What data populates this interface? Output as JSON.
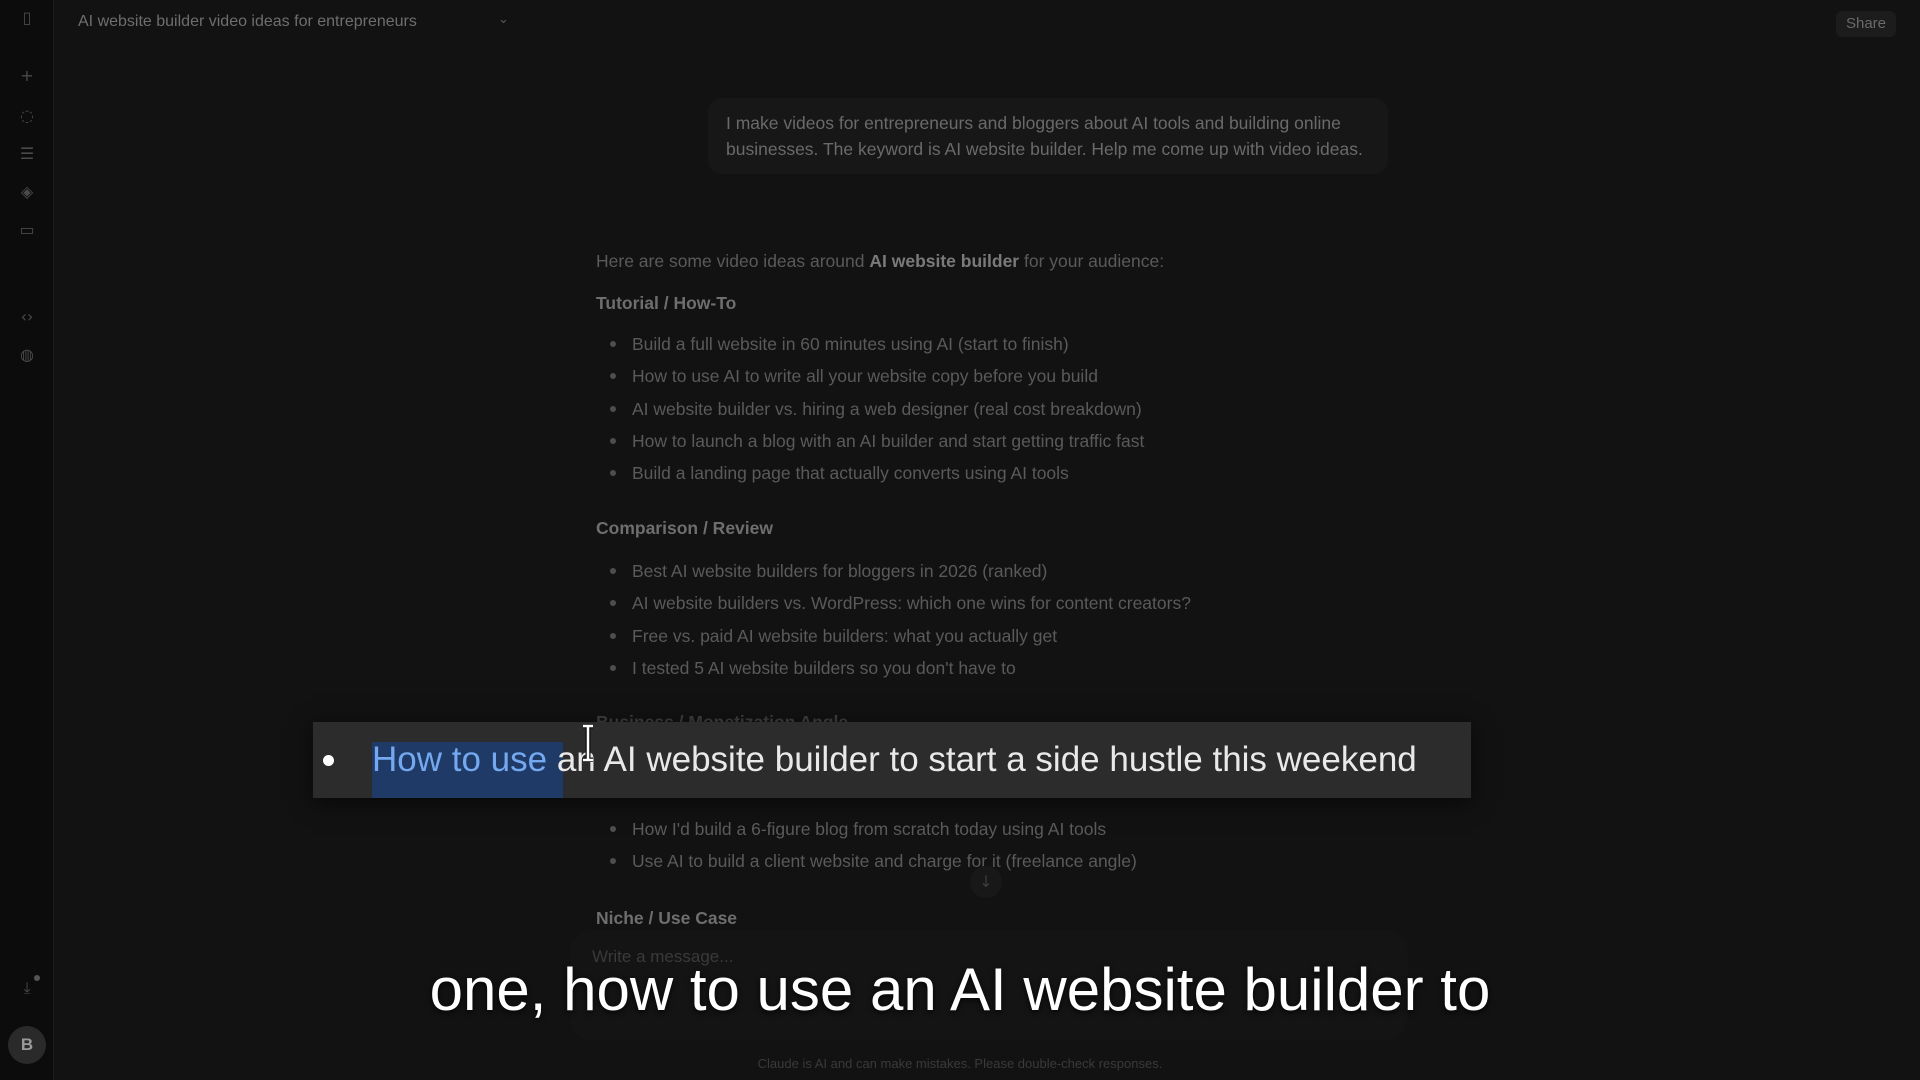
{
  "header": {
    "title": "AI website builder video ideas for entrepreneurs",
    "share_label": "Share"
  },
  "rail": {
    "icons": [
      "sidebar-toggle-icon",
      "plus-icon",
      "chat-icon",
      "stack-icon",
      "shapes-icon",
      "briefcase-icon",
      "code-icon",
      "palette-icon",
      "download-icon"
    ],
    "avatar_initial": "B"
  },
  "user_message": "I make videos for entrepreneurs and bloggers about AI tools and building online businesses. The keyword is AI website builder. Help me come up with video ideas.",
  "response": {
    "intro_pre": "Here are some video ideas around ",
    "intro_bold": "AI website builder",
    "intro_post": " for your audience:",
    "sections": [
      {
        "heading": "Tutorial / How-To",
        "items": [
          "Build a full website in 60 minutes using AI (start to finish)",
          "How to use AI to write all your website copy before you build",
          "AI website builder vs. hiring a web designer (real cost breakdown)",
          "How to launch a blog with an AI builder and start getting traffic fast",
          "Build a landing page that actually converts using AI tools"
        ]
      },
      {
        "heading": "Comparison / Review",
        "items": [
          "Best AI website builders for bloggers in 2026 (ranked)",
          "AI website builders vs. WordPress: which one wins for content creators?",
          "Free vs. paid AI website builders: what you actually get",
          "I tested 5 AI website builders so you don't have to"
        ]
      },
      {
        "heading": "Business / Monetization Angle",
        "items": [
          "How I'd build a 6-figure blog from scratch today using AI tools",
          "Use AI to build a client website and charge for it (freelance angle)"
        ]
      },
      {
        "heading": "Niche / Use Case",
        "items": []
      }
    ]
  },
  "highlight": {
    "selected": "How to use",
    "rest": " an AI website builder to start a side hustle this weekend"
  },
  "composer": {
    "placeholder": "Write a message..."
  },
  "disclaimer": "Claude is AI and can make mistakes. Please double-check responses.",
  "caption": "one, how to use an AI website builder to"
}
